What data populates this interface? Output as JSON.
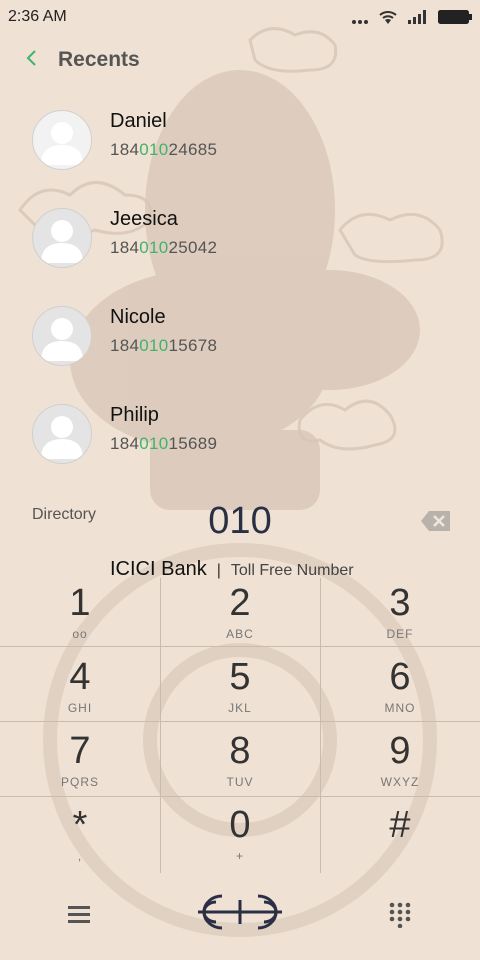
{
  "status": {
    "time": "2:36 AM"
  },
  "header": {
    "title": "Recents"
  },
  "contacts": [
    {
      "name": "Daniel",
      "num_pre": "184",
      "num_hl": "010",
      "num_post": "24685"
    },
    {
      "name": "Jeesica",
      "num_pre": "184",
      "num_hl": "010",
      "num_post": "25042"
    },
    {
      "name": "Nicole",
      "num_pre": "184",
      "num_hl": "010",
      "num_post": "15678"
    },
    {
      "name": "Philip",
      "num_pre": "184",
      "num_hl": "010",
      "num_post": "15689"
    }
  ],
  "dialer": {
    "directory_label": "Directory",
    "dialed_number": "010",
    "match_name": "ICICI Bank",
    "match_sep": "|",
    "match_desc": "Toll Free Number"
  },
  "keys": [
    {
      "digit": "1",
      "letters": "oo"
    },
    {
      "digit": "2",
      "letters": "ABC"
    },
    {
      "digit": "3",
      "letters": "DEF"
    },
    {
      "digit": "4",
      "letters": "GHI"
    },
    {
      "digit": "5",
      "letters": "JKL"
    },
    {
      "digit": "6",
      "letters": "MNO"
    },
    {
      "digit": "7",
      "letters": "PQRS"
    },
    {
      "digit": "8",
      "letters": "TUV"
    },
    {
      "digit": "9",
      "letters": "WXYZ"
    },
    {
      "digit": "*",
      "letters": ","
    },
    {
      "digit": "0",
      "letters": "+"
    },
    {
      "digit": "#",
      "letters": ""
    }
  ],
  "colors": {
    "accent": "#3fb46a",
    "background": "#efe1d3",
    "dialed": "#2a2f45"
  },
  "icons": {
    "back": "chevron-left-icon",
    "backspace": "backspace-icon",
    "menu": "menu-icon",
    "call": "call-logo-icon",
    "dialpad": "dialpad-icon"
  }
}
